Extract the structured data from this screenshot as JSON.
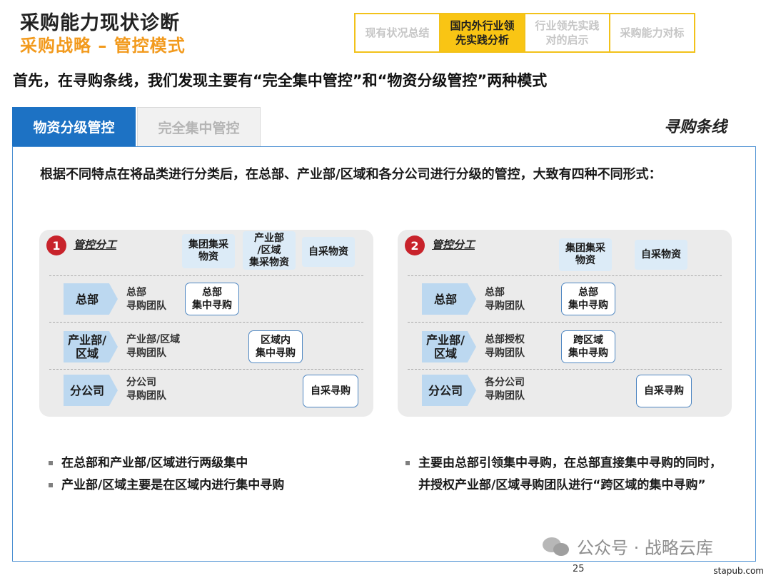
{
  "header": {
    "title": "采购能力现状诊断",
    "subtitle": "采购战略 – 管控模式",
    "nav_tabs": [
      {
        "label": "现有状况总结",
        "active": false
      },
      {
        "label": "国内外行业领\n先实践分析",
        "active": true
      },
      {
        "label": "行业领先实践\n对的启示",
        "active": false
      },
      {
        "label": "采购能力对标",
        "active": false
      }
    ]
  },
  "headline": "首先，在寻购条线，我们发现主要有“完全集中管控”和“物资分级管控”两种模式",
  "tabs": {
    "active": "物资分级管控",
    "inactive": "完全集中管控",
    "panel_tag": "寻购条线"
  },
  "intro": "根据不同特点在将品类进行分类后，在总部、产业部/区域和各分公司进行分级的管控，大致有四种不同形式：",
  "card1": {
    "number": "1",
    "mgmt_label": "管控分工",
    "col_heads": [
      "集团集采\n物资",
      "产业部\n/区域\n集采物资",
      "自采物资"
    ],
    "rows": [
      {
        "level": "总部",
        "team": "总部\n寻购团队",
        "box": "总部\n集中寻购"
      },
      {
        "level": "产业部/\n区域",
        "team": "产业部/区域\n寻购团队",
        "box": "区域内\n集中寻购"
      },
      {
        "level": "分公司",
        "team": "分公司\n寻购团队",
        "box": "自采寻购"
      }
    ]
  },
  "card2": {
    "number": "2",
    "mgmt_label": "管控分工",
    "col_heads": [
      "集团集采\n物资",
      "自采物资"
    ],
    "rows": [
      {
        "level": "总部",
        "team": "总部\n寻购团队",
        "box": "总部\n集中寻购"
      },
      {
        "level": "产业部/\n区域",
        "team": "总部授权\n寻购团队",
        "box": "跨区域\n集中寻购"
      },
      {
        "level": "分公司",
        "team": "各分公司\n寻购团队",
        "box": "自采寻购"
      }
    ]
  },
  "bullets_left": [
    "在总部和产业部/区域进行两级集中",
    "产业部/区域主要是在区域内进行集中寻购"
  ],
  "bullets_right": [
    "主要由总部引领集中寻购，在总部直接集中寻购的同时，并授权产业部/区域寻购团队进行“跨区域的集中寻购”"
  ],
  "watermark": "公众号 · 战略云库",
  "page_number": "25",
  "source": "stapub.com",
  "colors": {
    "accent_orange": "#f29a1d",
    "nav_yellow": "#f9c514",
    "tab_blue": "#1d72c4",
    "badge_red": "#c8232b",
    "chevron_blue": "#bcd8f0"
  }
}
